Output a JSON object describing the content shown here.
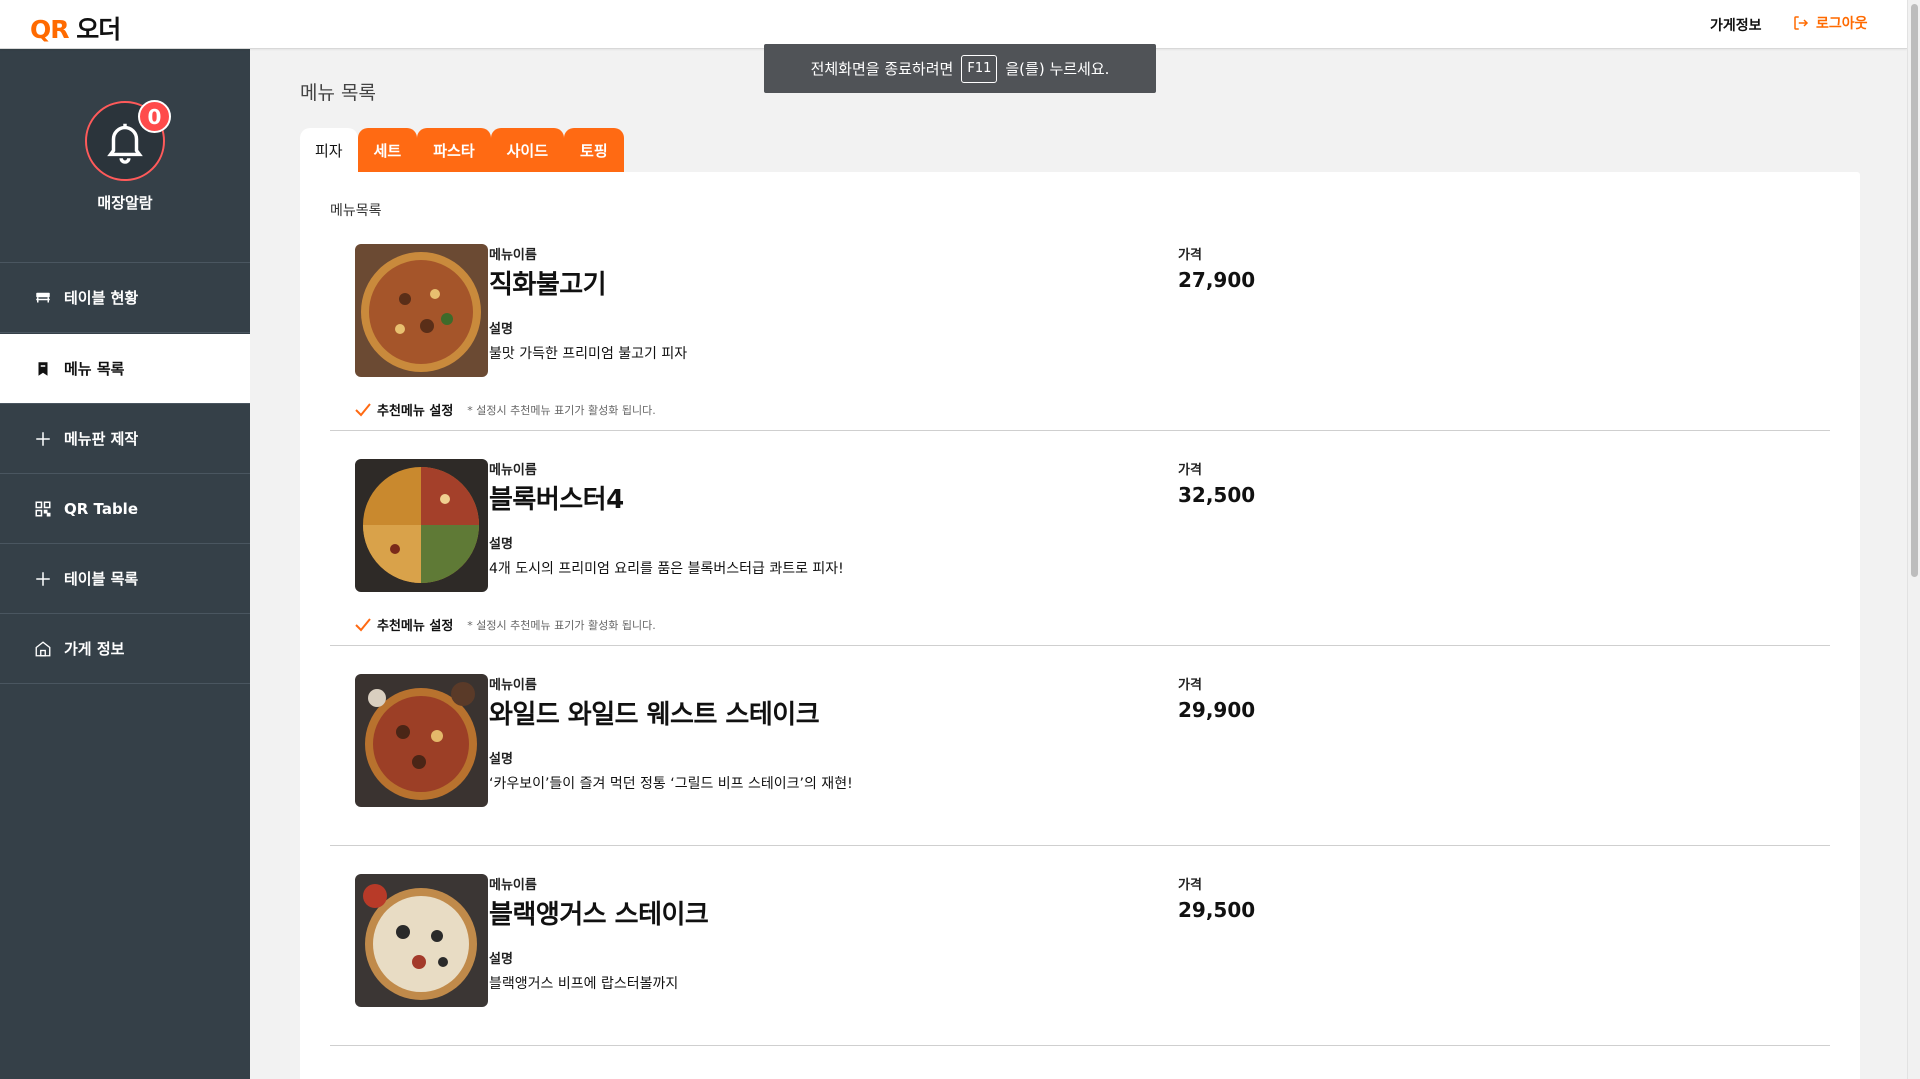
{
  "header": {
    "logo_prefix": "QR",
    "logo_suffix": "오더",
    "store_info": "가게정보",
    "logout": "로그아웃"
  },
  "toast": {
    "before": "전체화면을 종료하려면",
    "key": "F11",
    "after": "을(를) 누르세요."
  },
  "sidebar": {
    "alarm_count": "0",
    "alarm_label": "매장알람",
    "items": [
      {
        "label": "테이블 현황",
        "icon": "table-icon",
        "active": false
      },
      {
        "label": "메뉴 목록",
        "icon": "bookmark-icon",
        "active": true
      },
      {
        "label": "메뉴판 제작",
        "icon": "plus-icon",
        "active": false
      },
      {
        "label": "QR Table",
        "icon": "qr-icon",
        "active": false
      },
      {
        "label": "테이블 목록",
        "icon": "plus-icon",
        "active": false
      },
      {
        "label": "가게 정보",
        "icon": "store-icon",
        "active": false
      }
    ]
  },
  "main": {
    "title": "메뉴 목록",
    "tabs": [
      "피자",
      "세트",
      "파스타",
      "사이드",
      "토핑"
    ],
    "active_tab": "피자",
    "card_title": "메뉴목록",
    "field_labels": {
      "name": "메뉴이름",
      "desc": "설명",
      "price": "가격"
    },
    "reco_label": "추천메뉴 설정",
    "reco_note": "* 설정시 추천메뉴 표기가 활성화 됩니다.",
    "items": [
      {
        "name": "직화불고기",
        "desc": "불맛 가득한 프리미엄 불고기 피자",
        "price": "27,900",
        "recommended": true
      },
      {
        "name": "블록버스터4",
        "desc": "4개 도시의 프리미엄 요리를 품은 블록버스터급 콰트로 피자!",
        "price": "32,500",
        "recommended": true
      },
      {
        "name": "와일드 와일드 웨스트 스테이크",
        "desc": "‘카우보이’들이 즐겨 먹던 정통 ‘그릴드 비프 스테이크’의 재현!",
        "price": "29,900",
        "recommended": false
      },
      {
        "name": "블랙앵거스 스테이크",
        "desc": "블랙앵거스 비프에 랍스터볼까지",
        "price": "29,500",
        "recommended": false
      }
    ]
  },
  "colors": {
    "accent": "#ff6a13",
    "sidebar": "#354048",
    "badge": "#ff4b4b"
  }
}
